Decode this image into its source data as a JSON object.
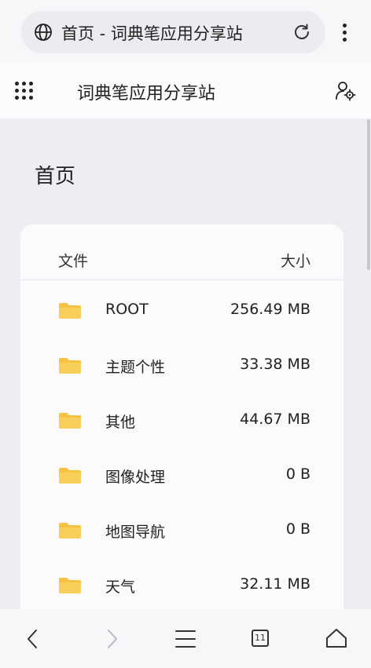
{
  "browser": {
    "url_title": "首页 - 词典笔应用分享站",
    "icons": [
      "globe-icon",
      "reload-icon",
      "more-vertical-icon"
    ]
  },
  "header": {
    "site_title": "词典笔应用分享站",
    "icons": [
      "apps-grid-icon",
      "user-settings-icon"
    ]
  },
  "page": {
    "title": "首页"
  },
  "table": {
    "columns": {
      "file": "文件",
      "size": "大小"
    },
    "rows": [
      {
        "name": "ROOT",
        "size": "256.49 MB"
      },
      {
        "name": "主题个性",
        "size": "33.38 MB"
      },
      {
        "name": "其他",
        "size": "44.67 MB"
      },
      {
        "name": "图像处理",
        "size": "0 B"
      },
      {
        "name": "地图导航",
        "size": "0 B"
      },
      {
        "name": "天气",
        "size": "32.11 MB"
      }
    ]
  },
  "bottom_nav": {
    "tab_count": "11",
    "icons": [
      "back-icon",
      "forward-icon",
      "menu-icon",
      "tabs-icon",
      "home-icon"
    ]
  },
  "colors": {
    "folder": "#f5c242",
    "background": "#ededf2",
    "card": "#fbfbfd"
  }
}
